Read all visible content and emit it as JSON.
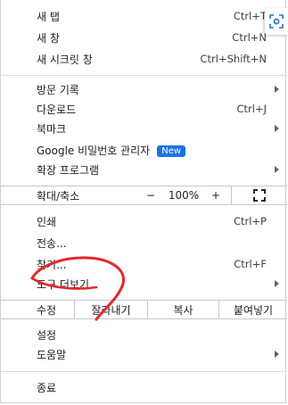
{
  "menu": {
    "items_top": [
      {
        "label": "새 탭",
        "shortcut": "Ctrl+T"
      },
      {
        "label": "새 창",
        "shortcut": "Ctrl+N"
      },
      {
        "label": "새 시크릿 창",
        "shortcut": "Ctrl+Shift+N"
      }
    ],
    "items_mid": [
      {
        "label": "방문 기록",
        "shortcut": ""
      },
      {
        "label": "다운로드",
        "shortcut": "Ctrl+J"
      },
      {
        "label": "북마크",
        "shortcut": ""
      },
      {
        "label": "Google 비밀번호 관리자",
        "badge": "New"
      },
      {
        "label": "확장 프로그램",
        "shortcut": ""
      }
    ],
    "zoom": {
      "label": "확대/축소",
      "minus": "−",
      "value": "100%",
      "plus": "+"
    },
    "items_page": [
      {
        "label": "인쇄",
        "shortcut": "Ctrl+P"
      },
      {
        "label": "전송...",
        "shortcut": ""
      },
      {
        "label": "찾기...",
        "shortcut": "Ctrl+F"
      },
      {
        "label": "도구 더보기",
        "shortcut": ""
      }
    ],
    "edit": {
      "label": "수정",
      "cut": "잘라내기",
      "copy": "복사",
      "paste": "붙여넣기"
    },
    "items_help": [
      {
        "label": "설정"
      },
      {
        "label": "도움말"
      }
    ],
    "exit": {
      "label": "종료"
    }
  },
  "colors": {
    "accent": "#1a73e8",
    "annotation": "#e8262a"
  },
  "icons": {
    "scan": "lens-scan-icon",
    "fullscreen": "fullscreen-icon",
    "submenu": "chevron-right-icon"
  }
}
